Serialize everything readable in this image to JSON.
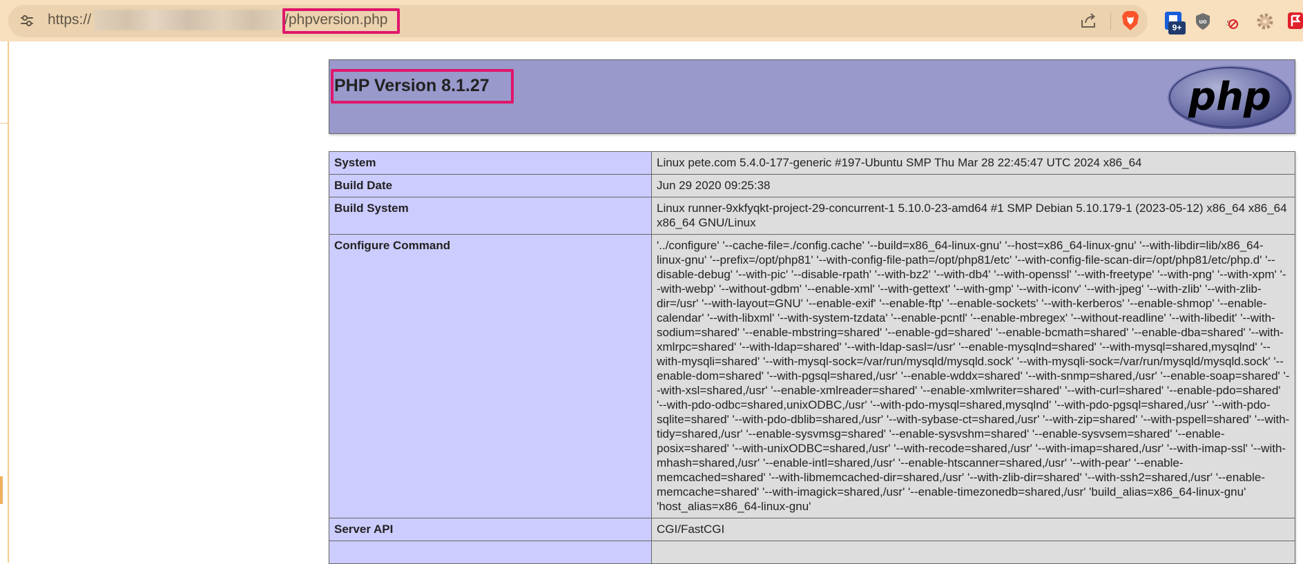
{
  "browser": {
    "url_scheme": "https://",
    "url_path": "/phpversion.php",
    "extension_badge": "9+",
    "icons": [
      "site-settings-icon",
      "share-icon",
      "brave-shields-icon",
      "bitwarden-icon",
      "ublock-origin-icon",
      "noscript-icon",
      "settings-gear-icon",
      "flag-extension-icon"
    ],
    "highlight_color": "#e0166b"
  },
  "php_header": {
    "title": "PHP Version 8.1.27",
    "logo_text": "php",
    "bg_color": "#9999cc"
  },
  "info_rows": [
    {
      "key": "System",
      "value": "Linux pete.com 5.4.0-177-generic #197-Ubuntu SMP Thu Mar 28 22:45:47 UTC 2024 x86_64"
    },
    {
      "key": "Build Date",
      "value": "Jun 29 2020 09:25:38"
    },
    {
      "key": "Build System",
      "value": "Linux runner-9xkfyqkt-project-29-concurrent-1 5.10.0-23-amd64 #1 SMP Debian 5.10.179-1 (2023-05-12) x86_64 x86_64 x86_64 GNU/Linux"
    },
    {
      "key": "Configure Command",
      "value": "'../configure' '--cache-file=./config.cache' '--build=x86_64-linux-gnu' '--host=x86_64-linux-gnu' '--with-libdir=lib/x86_64-linux-gnu' '--prefix=/opt/php81' '--with-config-file-path=/opt/php81/etc' '--with-config-file-scan-dir=/opt/php81/etc/php.d' '--disable-debug' '--with-pic' '--disable-rpath' '--with-bz2' '--with-db4' '--with-openssl' '--with-freetype' '--with-png' '--with-xpm' '--with-webp' '--without-gdbm' '--enable-xml' '--with-gettext' '--with-gmp' '--with-iconv' '--with-jpeg' '--with-zlib' '--with-zlib-dir=/usr' '--with-layout=GNU' '--enable-exif' '--enable-ftp' '--enable-sockets' '--with-kerberos' '--enable-shmop' '--enable-calendar' '--with-libxml' '--with-system-tzdata' '--enable-pcntl' '--enable-mbregex' '--without-readline' '--with-libedit' '--with-sodium=shared' '--enable-mbstring=shared' '--enable-gd=shared' '--enable-bcmath=shared' '--enable-dba=shared' '--with-xmlrpc=shared' '--with-ldap=shared' '--with-ldap-sasl=/usr' '--enable-mysqlnd=shared' '--with-mysql=shared,mysqlnd' '--with-mysqli=shared' '--with-mysql-sock=/var/run/mysqld/mysqld.sock' '--with-mysqli-sock=/var/run/mysqld/mysqld.sock' '--enable-dom=shared' '--with-pgsql=shared,/usr' '--enable-wddx=shared' '--with-snmp=shared,/usr' '--enable-soap=shared' '--with-xsl=shared,/usr' '--enable-xmlreader=shared' '--enable-xmlwriter=shared' '--with-curl=shared' '--enable-pdo=shared' '--with-pdo-odbc=shared,unixODBC,/usr' '--with-pdo-mysql=shared,mysqlnd' '--with-pdo-pgsql=shared,/usr' '--with-pdo-sqlite=shared' '--with-pdo-dblib=shared,/usr' '--with-sybase-ct=shared,/usr' '--with-zip=shared' '--with-pspell=shared' '--with-tidy=shared,/usr' '--enable-sysvmsg=shared' '--enable-sysvshm=shared' '--enable-sysvsem=shared' '--enable-posix=shared' '--with-unixODBC=shared,/usr' '--with-recode=shared,/usr' '--with-imap=shared,/usr' '--with-imap-ssl' '--with-mhash=shared,/usr' '--enable-intl=shared,/usr' '--enable-htscanner=shared,/usr' '--with-pear' '--enable-memcached=shared' '--with-libmemcached-dir=shared,/usr' '--with-zlib-dir=shared' '--with-ssh2=shared,/usr' '--enable-memcache=shared' '--with-imagick=shared,/usr' '--enable-timezonedb=shared,/usr' 'build_alias=x86_64-linux-gnu' 'host_alias=x86_64-linux-gnu'"
    },
    {
      "key": "Server API",
      "value": "CGI/FastCGI"
    },
    {
      "key": "",
      "value": ""
    }
  ]
}
